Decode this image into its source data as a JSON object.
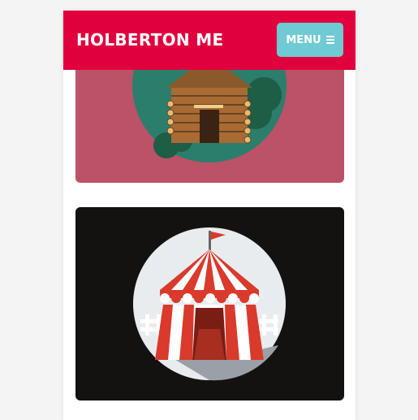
{
  "header": {
    "brand": "HOLBERTON ME",
    "menu_label": "MENU",
    "menu_icon": "hamburger-icon"
  },
  "cards": [
    {
      "icon": "log-cabin-icon",
      "background": "#bb5267"
    },
    {
      "icon": "circus-tent-icon",
      "background": "#141111"
    }
  ],
  "colors": {
    "header": "#e0003e",
    "menu_button": "#6fcbd3",
    "page": "#ffffff",
    "body": "#f4f4f4"
  }
}
